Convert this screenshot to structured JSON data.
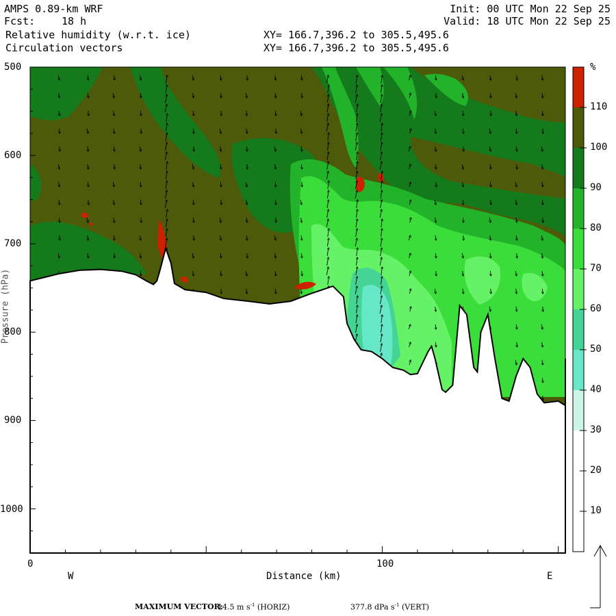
{
  "header": {
    "model": "AMPS 0.89-km WRF",
    "init": "Init: 00 UTC Mon 22 Sep 25",
    "fcst_label": "Fcst:",
    "fcst_value": "18 h",
    "valid": "Valid: 18 UTC Mon 22 Sep 25",
    "field1": "Relative humidity (w.r.t. ice)",
    "field2": "Circulation vectors",
    "xy1": "XY= 166.7,396.2 to 305.5,495.6",
    "xy2": "XY= 166.7,396.2 to 305.5,495.6"
  },
  "chart_data": {
    "type": "contour-cross-section",
    "title": "Relative humidity (w.r.t. ice)",
    "xlabel": "Distance (km)",
    "ylabel": "Pressure (hPa)",
    "x_ticks": [
      "0",
      "100"
    ],
    "x_ends": [
      "W",
      "E"
    ],
    "y_ticks": [
      "500",
      "600",
      "700",
      "800",
      "900",
      "1000"
    ],
    "xlim": [
      0,
      152
    ],
    "ylim": [
      500,
      1050
    ],
    "colorbar": {
      "unit": "%",
      "levels": [
        "110",
        "100",
        "90",
        "80",
        "70",
        "60",
        "50",
        "40",
        "30",
        "20",
        "10"
      ],
      "colors": [
        "#cc2200",
        "#4d5a0a",
        "#157a1c",
        "#22b32a",
        "#3bdd3b",
        "#66f266",
        "#44d596",
        "#66e8c8",
        "#ccf5e6",
        "#ffffff",
        "#ffffff",
        "#ffffff"
      ]
    },
    "terrain_hpa": [
      [
        0,
        742
      ],
      [
        8,
        734
      ],
      [
        14,
        730
      ],
      [
        20,
        729
      ],
      [
        26,
        731
      ],
      [
        30,
        735
      ],
      [
        33,
        742
      ],
      [
        35,
        746
      ],
      [
        36,
        742
      ],
      [
        37,
        728
      ],
      [
        38.5,
        705
      ],
      [
        40,
        722
      ],
      [
        41,
        745
      ],
      [
        44,
        752
      ],
      [
        50,
        755
      ],
      [
        55,
        762
      ],
      [
        62,
        765
      ],
      [
        68,
        768
      ],
      [
        74,
        765
      ],
      [
        80,
        756
      ],
      [
        86,
        748
      ],
      [
        89,
        760
      ],
      [
        90,
        790
      ],
      [
        92,
        808
      ],
      [
        94,
        820
      ],
      [
        97,
        822
      ],
      [
        100,
        830
      ],
      [
        103,
        840
      ],
      [
        106,
        843
      ],
      [
        108,
        848
      ],
      [
        110,
        847
      ],
      [
        113,
        822
      ],
      [
        114,
        816
      ],
      [
        115,
        830
      ],
      [
        117,
        865
      ],
      [
        118,
        868
      ],
      [
        120,
        860
      ],
      [
        122,
        770
      ],
      [
        124,
        780
      ],
      [
        126,
        840
      ],
      [
        127,
        845
      ],
      [
        128,
        800
      ],
      [
        130,
        780
      ],
      [
        132,
        830
      ],
      [
        134,
        875
      ],
      [
        136,
        878
      ],
      [
        138,
        850
      ],
      [
        140,
        830
      ],
      [
        142,
        840
      ],
      [
        144,
        870
      ],
      [
        146,
        880
      ],
      [
        150,
        878
      ],
      [
        152,
        883
      ],
      [
        154,
        875
      ],
      [
        156,
        860
      ],
      [
        158,
        850
      ],
      [
        160,
        870
      ],
      [
        162,
        875
      ],
      [
        164,
        860
      ],
      [
        166,
        840
      ],
      [
        167,
        830
      ]
    ],
    "max_vector_horiz": "14.5 m s⁻¹ (HORIZ)",
    "max_vector_vert": "377.8 dPa s⁻¹ (VERT)"
  },
  "footer": {
    "label": "MAXIMUM VECTOR:",
    "horiz_value": "14.5",
    "horiz_unit": "m s",
    "horiz_exp": "-1",
    "horiz_tag": "(HORIZ)",
    "vert_value": "377.8",
    "vert_unit": "dPa s",
    "vert_exp": "-1",
    "vert_tag": "(VERT)"
  }
}
